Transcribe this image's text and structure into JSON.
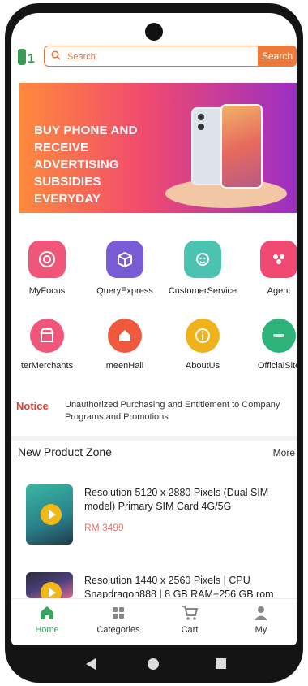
{
  "search": {
    "placeholder": "Search",
    "button_label": "Search"
  },
  "banner": {
    "lines": [
      "BUY PHONE AND RECEIVE",
      "ADVERTISING SUBSIDIES",
      "EVERYDAY"
    ]
  },
  "shortcuts": [
    {
      "label": "MyFocus",
      "icon": "target-icon",
      "color": "#f0567a"
    },
    {
      "label": "QueryExpress",
      "icon": "package-icon",
      "color": "#7a5bd6"
    },
    {
      "label": "CustomerService",
      "icon": "headset-icon",
      "color": "#4cc3b0"
    },
    {
      "label": "Agent",
      "icon": "group-icon",
      "color": "#f04a73"
    },
    {
      "label": "terMerchants",
      "icon": "store-icon",
      "color": "#f0567a"
    },
    {
      "label": "meenHall",
      "icon": "home-icon",
      "color": "#ef5a3e"
    },
    {
      "label": "AboutUs",
      "icon": "info-icon",
      "color": "#f0b21a"
    },
    {
      "label": "OfficialSite",
      "icon": "website-icon",
      "color": "#2db37a"
    }
  ],
  "notice": {
    "tag": "Notice",
    "text": "Unauthorized Purchasing and Entitlement to Company Programs and Promotions"
  },
  "zone": {
    "title": "New Product Zone",
    "more": "More"
  },
  "products": [
    {
      "title": "Resolution 5120 x 2880 Pixels (Dual SIM model) Primary SIM Card 4G/5G",
      "price": "RM 3499"
    },
    {
      "title": "Resolution 1440 x 2560 Pixels | CPU Snapdragon888 | 8 GB RAM+256 GB rom",
      "price": ""
    }
  ],
  "tabs": [
    {
      "label": "Home",
      "icon": "home-icon"
    },
    {
      "label": "Categories",
      "icon": "grid-icon"
    },
    {
      "label": "Cart",
      "icon": "cart-icon"
    },
    {
      "label": "My",
      "icon": "user-icon"
    }
  ],
  "colors": {
    "accent": "#ec7a3b",
    "active_tab": "#3aa35e",
    "notice": "#e53b32",
    "price": "#e8736a"
  }
}
